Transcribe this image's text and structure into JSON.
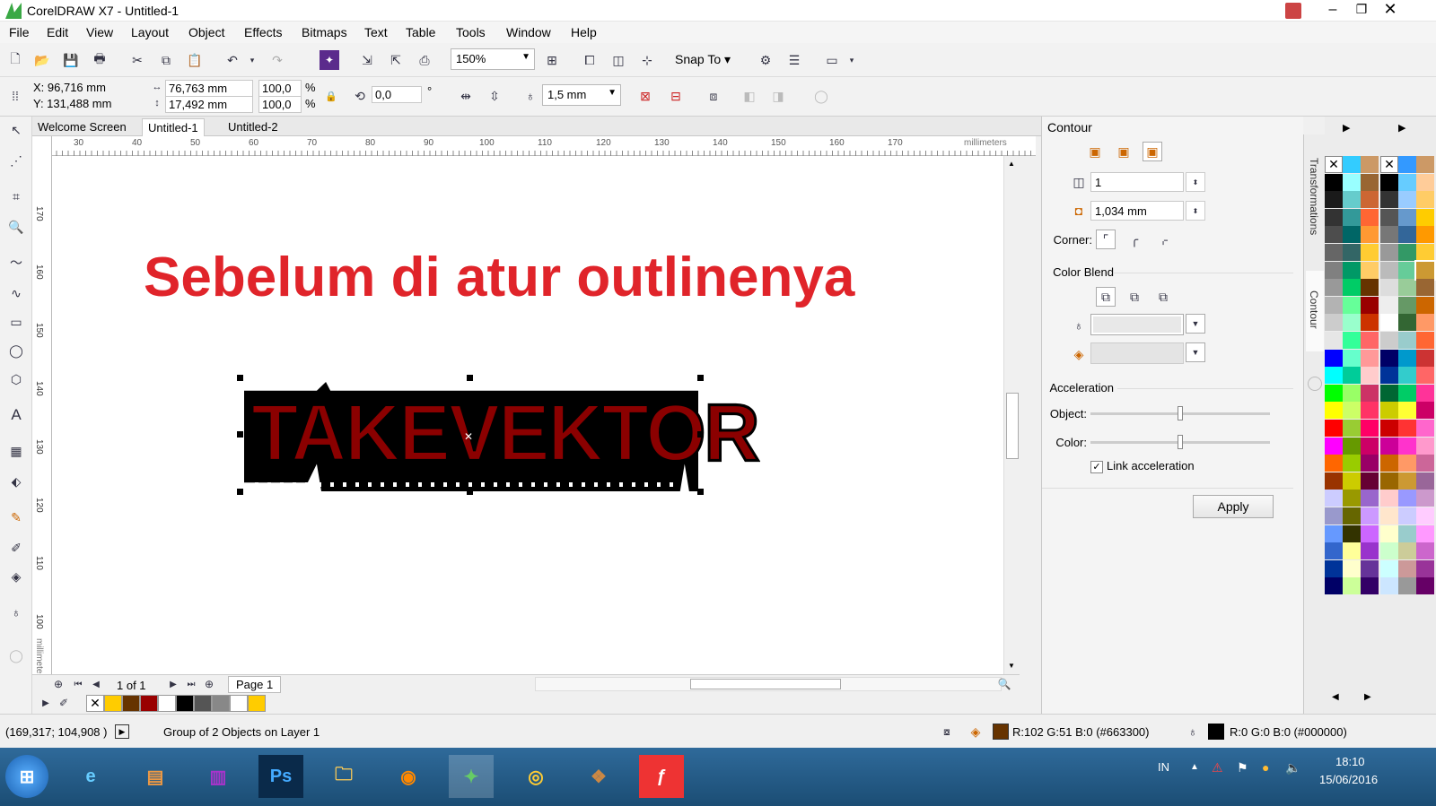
{
  "window": {
    "title": "CorelDRAW X7 - Untitled-1"
  },
  "menu": [
    "File",
    "Edit",
    "View",
    "Layout",
    "Object",
    "Effects",
    "Bitmaps",
    "Text",
    "Table",
    "Tools",
    "Window",
    "Help"
  ],
  "toolbar": {
    "zoom": "150%",
    "snap": "Snap To"
  },
  "property_bar": {
    "x": "X: 96,716 mm",
    "y": "Y: 131,488 mm",
    "width": "76,763 mm",
    "height": "17,492 mm",
    "scale_x": "100,0",
    "scale_y": "100,0",
    "pct1": "%",
    "pct2": "%",
    "angle": "0,0",
    "degree": "°",
    "outline": "1,5 mm"
  },
  "tabs": [
    "Welcome Screen",
    "Untitled-1",
    "Untitled-2"
  ],
  "ruler": {
    "h": [
      "30",
      "40",
      "50",
      "60",
      "70",
      "80",
      "90",
      "100",
      "110",
      "120",
      "130",
      "140",
      "150",
      "160",
      "170"
    ],
    "unit": "millimeters",
    "v": [
      "170",
      "160",
      "150",
      "140",
      "130",
      "120",
      "110",
      "100"
    ]
  },
  "canvas": {
    "heading": "Sebelum di atur outlinenya",
    "logo": "TAKEVEKTOR"
  },
  "colors": {
    "heading": "#e0242a",
    "logo_fill": "#8b0000",
    "logo_outline": "#000000"
  },
  "page_nav": {
    "counter": "1 of 1",
    "page": "Page 1"
  },
  "docker": {
    "title": "Contour",
    "steps": "1",
    "offset": "1,034 mm",
    "corner_label": "Corner:",
    "color_blend": "Color Blend",
    "acceleration": "Acceleration",
    "object_label": "Object:",
    "color_label": "Color:",
    "link_label": "Link acceleration",
    "link_checked": true,
    "apply": "Apply",
    "object_accel": 0.5,
    "color_accel": 0.5
  },
  "side_tabs": [
    "Transformations",
    "Contour"
  ],
  "status": {
    "coords": "(169,317; 104,908 )",
    "info": "Group of 2 Objects on Layer 1",
    "fill": "R:102 G:51 B:0 (#663300)",
    "outline": "R:0 G:0 B:0 (#000000)"
  },
  "taskbar": {
    "lang": "IN",
    "time": "18:10",
    "date": "15/06/2016"
  }
}
